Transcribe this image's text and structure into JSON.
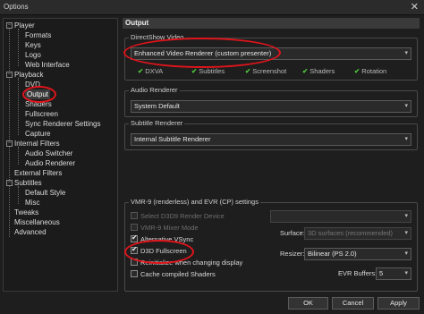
{
  "window": {
    "title": "Options",
    "close_glyph": "✕"
  },
  "tree": {
    "items": [
      {
        "label": "Player",
        "level": 0,
        "expander": "−"
      },
      {
        "label": "Formats",
        "level": 1
      },
      {
        "label": "Keys",
        "level": 1
      },
      {
        "label": "Logo",
        "level": 1
      },
      {
        "label": "Web Interface",
        "level": 1
      },
      {
        "label": "Playback",
        "level": 0,
        "expander": "−"
      },
      {
        "label": "DVD",
        "level": 1
      },
      {
        "label": "Output",
        "level": 1,
        "selected": true
      },
      {
        "label": "Shaders",
        "level": 1
      },
      {
        "label": "Fullscreen",
        "level": 1
      },
      {
        "label": "Sync Renderer Settings",
        "level": 1
      },
      {
        "label": "Capture",
        "level": 1
      },
      {
        "label": "Internal Filters",
        "level": 0,
        "expander": "−"
      },
      {
        "label": "Audio Switcher",
        "level": 1
      },
      {
        "label": "Audio Renderer",
        "level": 1
      },
      {
        "label": "External Filters",
        "level": 0
      },
      {
        "label": "Subtitles",
        "level": 0,
        "expander": "−"
      },
      {
        "label": "Default Style",
        "level": 1
      },
      {
        "label": "Misc",
        "level": 1
      },
      {
        "label": "Tweaks",
        "level": 0
      },
      {
        "label": "Miscellaneous",
        "level": 0
      },
      {
        "label": "Advanced",
        "level": 0
      }
    ]
  },
  "pane": {
    "header": "Output",
    "directshow": {
      "group_label": "DirectShow Video",
      "renderer": "Enhanced Video Renderer (custom presenter)",
      "capabilities": [
        "DXVA",
        "Subtitles",
        "Screenshot",
        "Shaders",
        "Rotation"
      ]
    },
    "audio": {
      "group_label": "Audio Renderer",
      "value": "System Default"
    },
    "subtitle": {
      "group_label": "Subtitle Renderer",
      "value": "Internal Subtitle Renderer"
    },
    "vmr": {
      "group_label": "VMR-9 (renderless) and EVR (CP) settings",
      "select_device": "Select D3D9 Render Device",
      "mixer_mode": "VMR-9 Mixer Mode",
      "alt_vsync": "Alternative VSync",
      "d3d_fullscreen": "D3D Fullscreen",
      "reinit": "Reinitialize when changing display",
      "cache_shaders": "Cache compiled Shaders",
      "surface_label": "Surface:",
      "surface_value": "3D surfaces (recommended)",
      "resizer_label": "Resizer:",
      "resizer_value": "Bilinear (PS 2.0)",
      "evr_buffers_label": "EVR Buffers:",
      "evr_buffers_value": "5"
    }
  },
  "buttons": {
    "ok": "OK",
    "cancel": "Cancel",
    "apply": "Apply"
  },
  "colors": {
    "annotation_red": "#e0141b",
    "check_green": "#4fc83c"
  }
}
